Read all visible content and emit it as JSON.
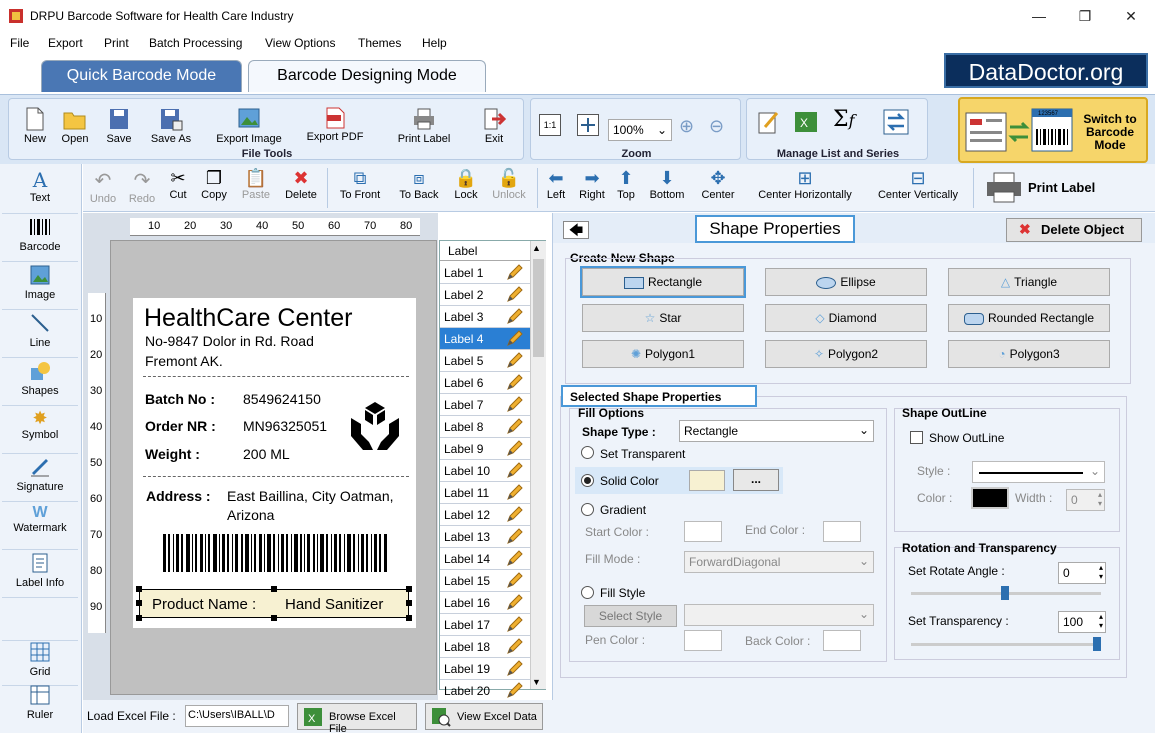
{
  "window": {
    "title": "DRPU Barcode Software for Health Care Industry",
    "minimize": "—",
    "maximize": "❐",
    "close": "✕"
  },
  "menu": [
    "File",
    "Export",
    "Print",
    "Batch Processing",
    "View Options",
    "Themes",
    "Help"
  ],
  "mode_tabs": {
    "quick": "Quick Barcode Mode",
    "designing": "Barcode Designing Mode"
  },
  "brand": {
    "logo_text": "DataDoctor.org",
    "color": "#0b2e5c"
  },
  "file_tools": {
    "label": "File Tools",
    "buttons": [
      "New",
      "Open",
      "Save",
      "Save As",
      "Export Image",
      "Export PDF",
      "Print Label",
      "Exit"
    ]
  },
  "zoom": {
    "label": "Zoom",
    "value": "100%"
  },
  "manage": {
    "label": "Manage List and Series"
  },
  "switch_mode": {
    "line1": "Switch to",
    "line2": "Barcode",
    "line3": "Mode",
    "sample_number": "123567"
  },
  "left_tools": [
    "Text",
    "Barcode",
    "Image",
    "Line",
    "Shapes",
    "Symbol",
    "Signature",
    "Watermark",
    "Label Info",
    "Grid",
    "Ruler"
  ],
  "edit_toolbar": {
    "buttons": [
      "Undo",
      "Redo",
      "Cut",
      "Copy",
      "Paste",
      "Delete",
      "To Front",
      "To Back",
      "Lock",
      "Unlock",
      "Left",
      "Right",
      "Top",
      "Bottom",
      "Center",
      "Center Horizontally",
      "Center Vertically"
    ],
    "print_label": "Print Label"
  },
  "ruler": {
    "top": [
      "10",
      "20",
      "30",
      "40",
      "50",
      "60",
      "70",
      "80"
    ],
    "left": [
      "10",
      "20",
      "30",
      "40",
      "50",
      "60",
      "70",
      "80",
      "90"
    ]
  },
  "label": {
    "org": "HealthCare Center",
    "addr1": "No-9847 Dolor in Rd.  Road",
    "addr2": "Fremont AK.",
    "batch_k": "Batch No :",
    "batch_v": "8549624150",
    "order_k": "Order NR :",
    "order_v": "MN96325051",
    "weight_k": "Weight :",
    "weight_v": "200 ML",
    "address_k": "Address :",
    "address_v1": "East Baillina, City Oatman,",
    "address_v2": "Arizona",
    "product_k": "Product Name :",
    "product_v": "Hand Sanitizer"
  },
  "label_list": {
    "header": "Label",
    "items": [
      "Label 1",
      "Label 2",
      "Label 3",
      "Label 4",
      "Label 5",
      "Label 6",
      "Label 7",
      "Label 8",
      "Label 9",
      "Label 10",
      "Label 11",
      "Label 12",
      "Label 13",
      "Label 14",
      "Label 15",
      "Label 16",
      "Label 17",
      "Label 18",
      "Label 19",
      "Label 20"
    ],
    "selected_index": 3
  },
  "shape_props": {
    "title": "Shape Properties",
    "delete": "Delete Object",
    "create_new": "Create New Shape",
    "shapes": [
      "Rectangle",
      "Ellipse",
      "Triangle",
      "Star",
      "Diamond",
      "Rounded Rectangle",
      "Polygon1",
      "Polygon2",
      "Polygon3"
    ],
    "selected_heading": "Selected Shape Properties",
    "fill_options": "Fill Options",
    "shape_type_label": "Shape Type :",
    "shape_type_value": "Rectangle",
    "set_transparent": "Set Transparent",
    "solid_color": "Solid Color",
    "solid_color_btn": "...",
    "gradient": "Gradient",
    "start_color": "Start Color :",
    "end_color": "End Color :",
    "fill_mode": "Fill Mode :",
    "fill_mode_value": "ForwardDiagonal",
    "fill_style": "Fill Style",
    "select_style": "Select Style",
    "pen_color": "Pen Color :",
    "back_color": "Back Color :",
    "outline_heading": "Shape OutLine",
    "show_outline": "Show OutLine",
    "style_label": "Style :",
    "color_label": "Color :",
    "width_label": "Width :",
    "width_value": "0",
    "rotation_heading": "Rotation and Transparency",
    "rotate_label": "Set Rotate Angle :",
    "rotate_value": "0",
    "transparency_label": "Set Transparency :",
    "transparency_value": "100",
    "solid_swatch": "#f7f1d2"
  },
  "bottom": {
    "load_label": "Load Excel File :",
    "path": "C:\\Users\\IBALL\\D",
    "browse": "Browse Excel File",
    "view": "View Excel Data"
  }
}
